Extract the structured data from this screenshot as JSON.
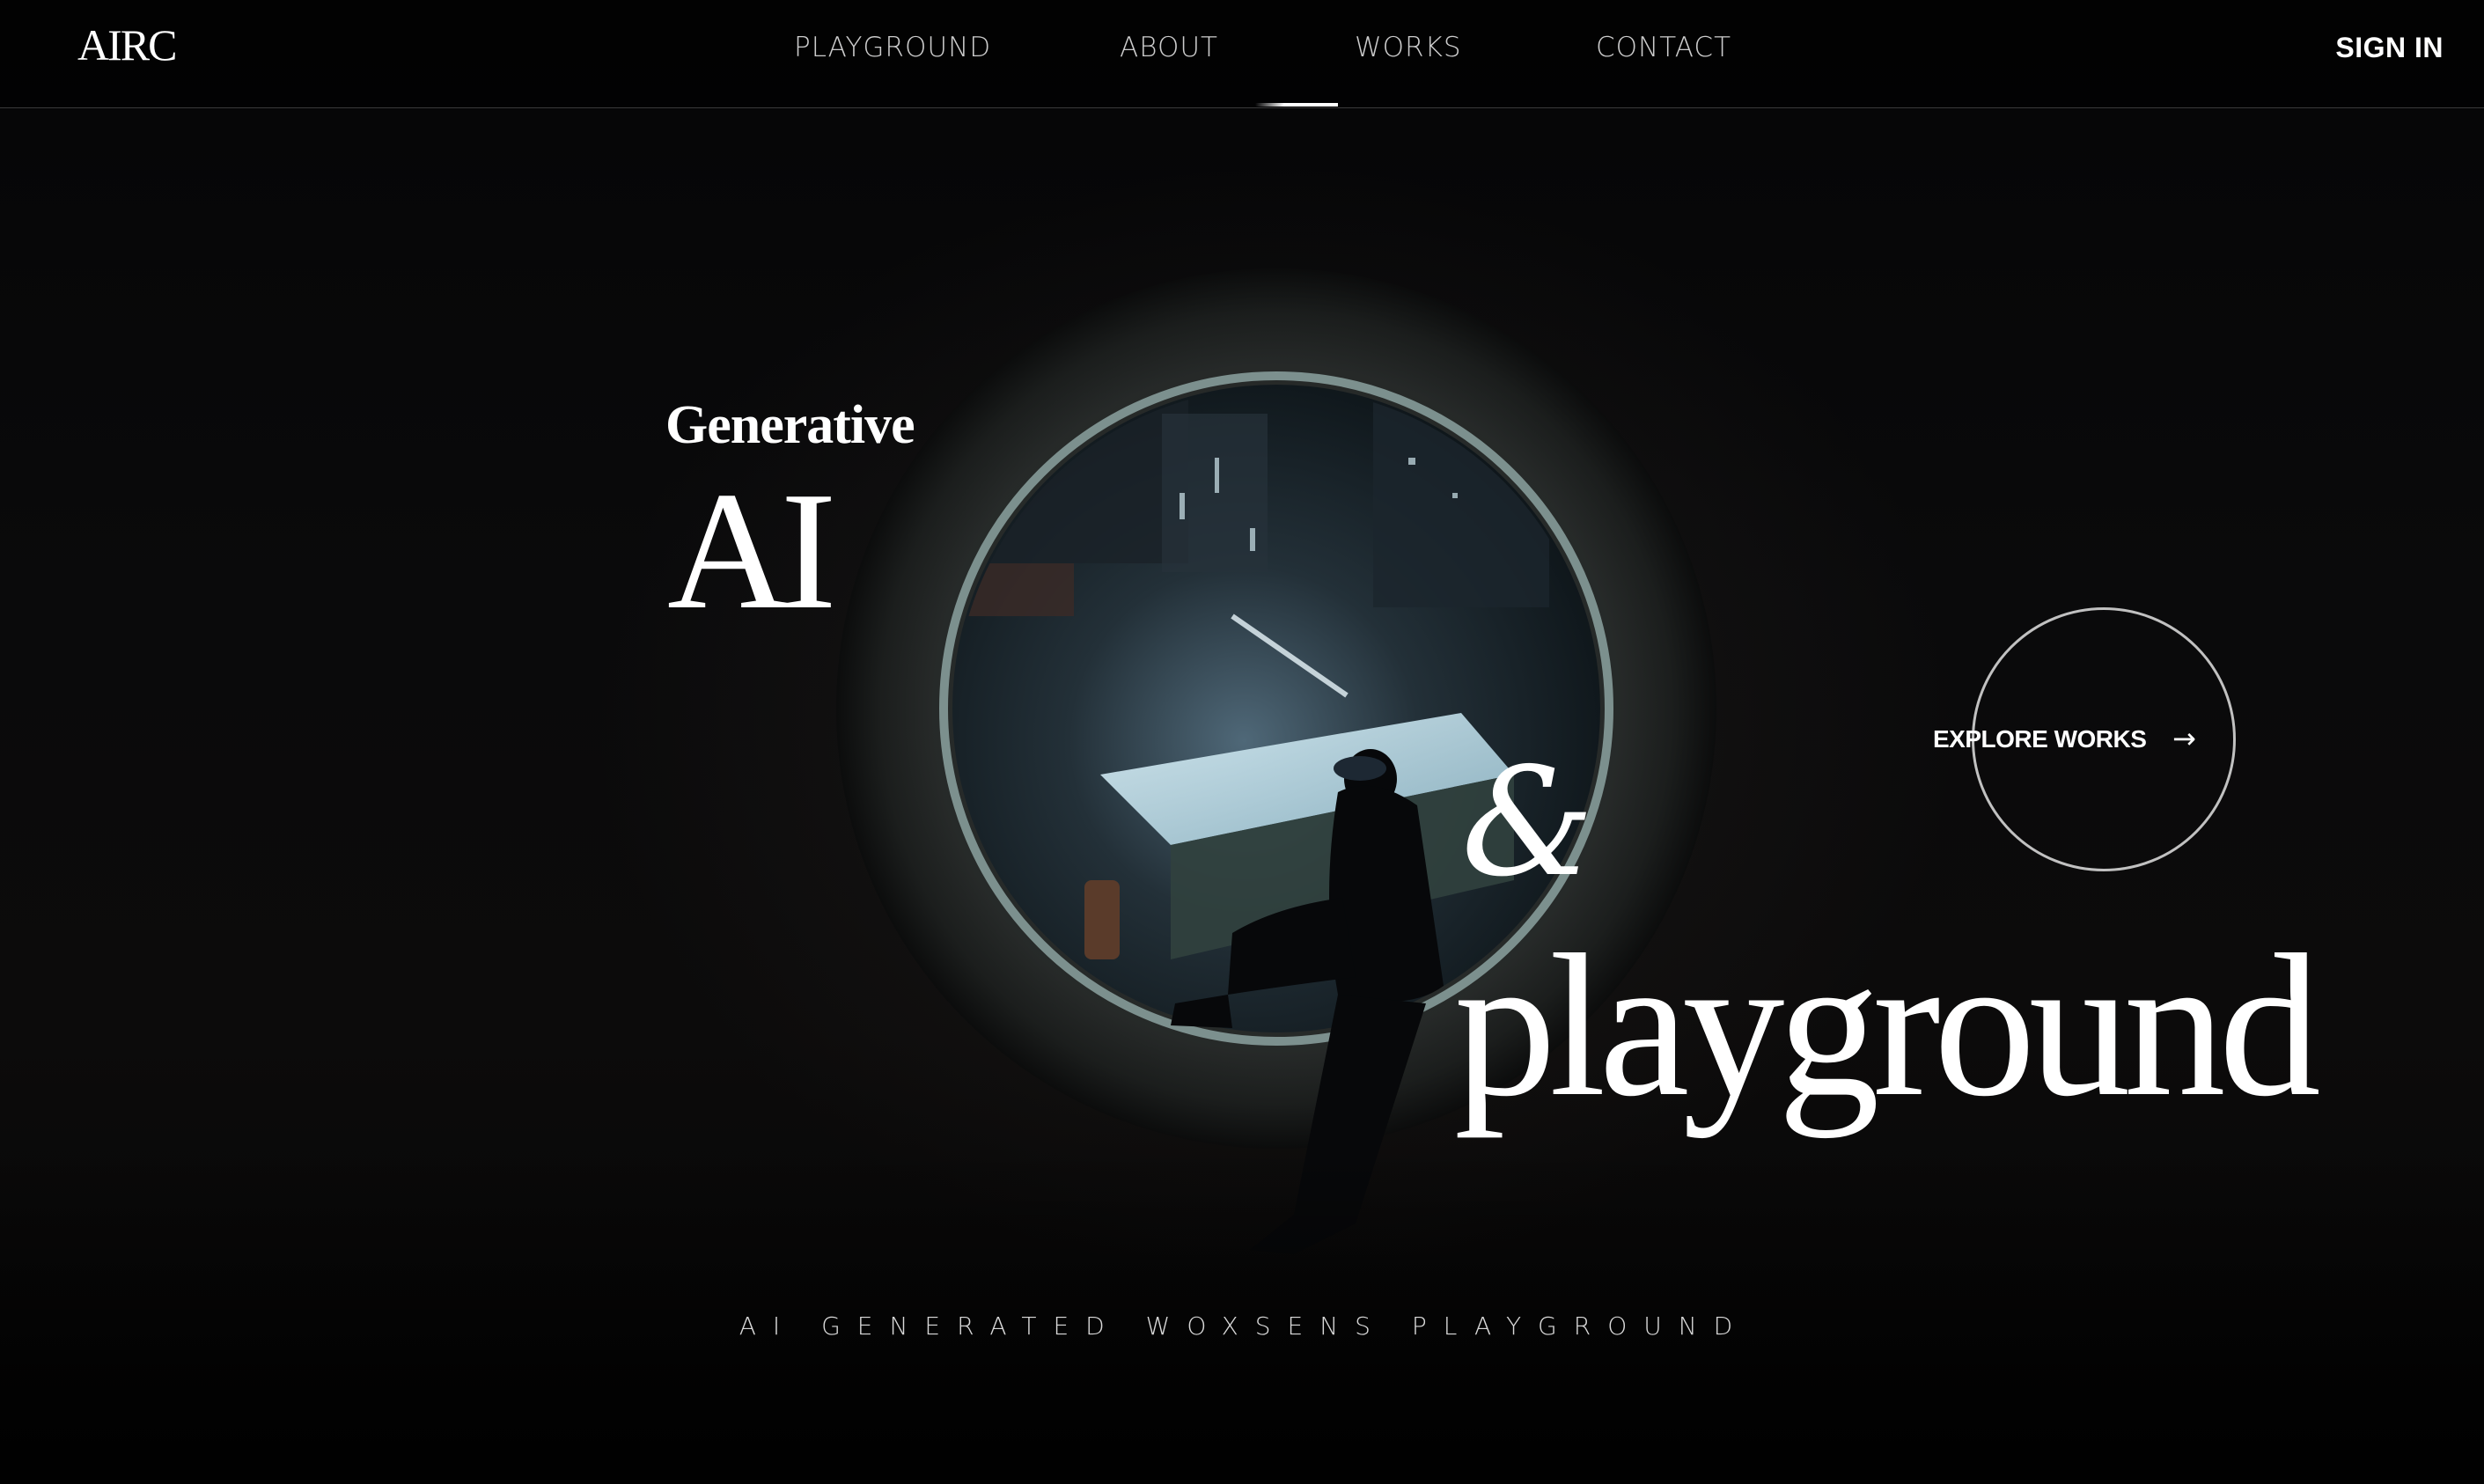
{
  "header": {
    "logo": "AIRC",
    "nav": [
      "PLAYGROUND",
      "ABOUT",
      "WORKS",
      "CONTACT"
    ],
    "sign_in": "SIGN IN"
  },
  "hero": {
    "line1": "Generative",
    "line2": "AI",
    "ampersand": "&",
    "line3": "playground",
    "tagline": "AI GENERATED WOXSENS PLAYGROUND"
  },
  "cta": {
    "label": "EXPLORE WORKS",
    "icon": "arrow-right-icon"
  },
  "colors": {
    "background": "#000000",
    "text": "#ffffff"
  }
}
